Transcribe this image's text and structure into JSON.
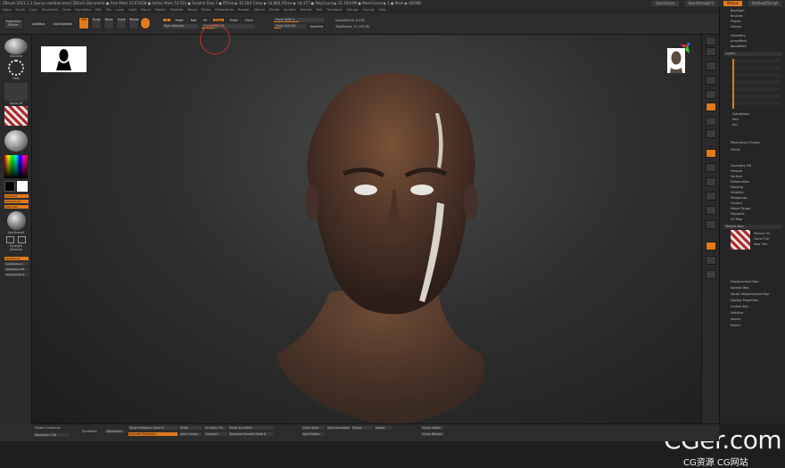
{
  "window": {
    "title": "ZBrush 2021.1.2 [bonus zombiename]   ZBrush Document   ● Free Mem 33.674GB ● Active Mem 74.523 ● Scratch Disk 7 ● RTime ▶ 35.504 Timer ▶ 34.806 ATime ▶ 18.477 ● PolyCount ▶ 21.193 MP ● MeshCount ▶ 1 ● Mem ▶ 600MB",
    "quicksave": "QuickSave",
    "seethrough": "See-through 0",
    "menus": "Menus",
    "default_script": "DefaultZScript"
  },
  "menubar": [
    "Alpha",
    "Brush",
    "Color",
    "Document",
    "Draw",
    "Dynamics",
    "Edit",
    "File",
    "Layer",
    "Light",
    "Macro",
    "Marker",
    "Material",
    "Movie",
    "Picker",
    "Preferences",
    "Render",
    "Stencil",
    "Stroke",
    "Surface",
    "Texture",
    "Tool",
    "Transform",
    "Zplugin",
    "Zscript",
    "Help"
  ],
  "toolbar": {
    "buttons": {
      "projection_master": "Projection Master",
      "lightbox": "LightBox",
      "live_boolean": "Live Boolean",
      "edit": "Edit",
      "draw": "Draw",
      "move": "Move",
      "scale": "Scale",
      "rotate": "Rotate",
      "a": "A",
      "mrgb": "Mrgb",
      "rgb": "Rgb",
      "m": "M",
      "zadd": "Zadd",
      "zsub": "Zsub",
      "zcut": "Zcut"
    },
    "rgb_intensity": "Rgb Intensity",
    "z_intensity": "Z Intensity 25",
    "focal_shift": "Focal Shift 0",
    "draw_size": "Draw Size 64",
    "dynamic": "Dynamic",
    "active_points": "ActivePoints: 6.278",
    "total_points": "TotalPoints: 21.193 Mil"
  },
  "left_tray": {
    "brush_name": "Standard",
    "stroke_name": "Dots",
    "alpha_name": "Alpha Off",
    "texture_name": "Texture Off",
    "material_name": "MatCap Red",
    "gradient": "Gradient",
    "switch_color": "SwitchColor",
    "alternate": "Alternate",
    "material_label": "SkinShade4",
    "symmetry": "LazyMouse",
    "lazy_radius": "LazyRadius 1",
    "lazy_step": "LazyStep 0.25",
    "lazy_smooth": "LazySmooth 0",
    "spot_label": "Spotlight Selection"
  },
  "right_panel": {
    "items": [
      "Geometry",
      "ArrayMesh",
      "NanoMesh",
      "Layers",
      "Subdivision",
      "Smt",
      "Suv",
      "Reconstruct Subdiv",
      "Divide",
      "Geometry HD",
      "Preview",
      "Surface",
      "Deformation",
      "Masking",
      "Visibility",
      "Polygroups",
      "Contact",
      "Morph Target",
      "Polypaint",
      "UV Map",
      "Texture Map",
      "Texture On",
      "Clone Txtr",
      "New Txtr",
      "Displacement Map",
      "Normal Map",
      "Vector Displacement Map",
      "Display Properties",
      "Unified Skin",
      "Initialize",
      "Import",
      "Export"
    ],
    "top_items": [
      "Backlight",
      "Brushes",
      "Project",
      "Extract"
    ]
  },
  "bottom": {
    "enable_customize": "Enable Customize",
    "resolution": "Resolution 128",
    "polish": "Polish",
    "dynamesh": "DynaMesh",
    "target_polygons": "Target Polygons Count 8",
    "activate_symmetry": "Activate Symmetry",
    "zremesher": "ZRemesher",
    "sculptris": "Sculptris Pro",
    "close_holes": "Close Holes",
    "split_unmasked": "Split Unmasked",
    "mirror_weld": "Mirror And Weld",
    "split_hidden": "Split Hidden",
    "export": "Export",
    "import": "Import",
    "group_visible": "Group Visible",
    "group_masked": "Group Masked",
    "weighted_smooth": "Weighted Smooth Mode 8",
    "auto_groups": "Auto Groups",
    "polypaint": "Polypaint"
  },
  "watermark": {
    "big": "CGer.com",
    "small": "CG资源 CG网站"
  }
}
